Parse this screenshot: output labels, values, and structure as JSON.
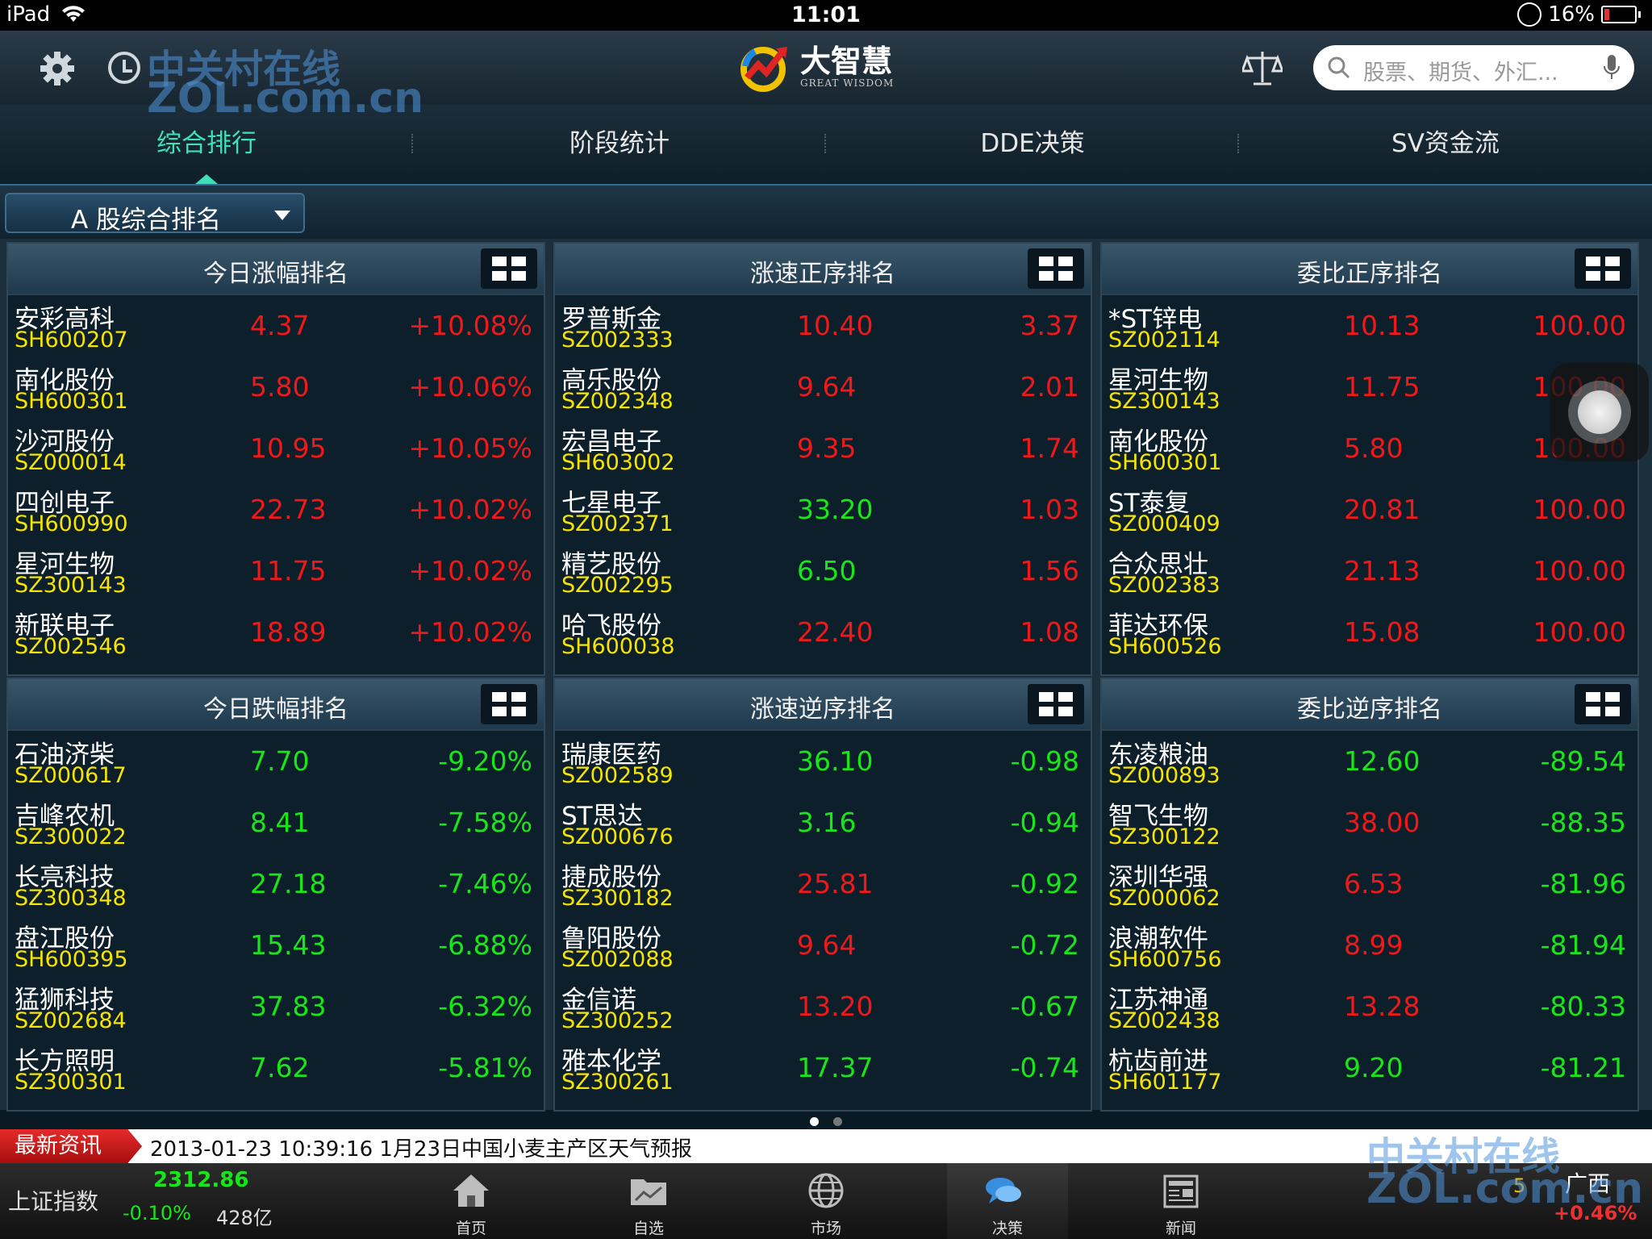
{
  "status": {
    "device": "iPad",
    "time": "11:01",
    "battery": "16%"
  },
  "header": {
    "brand": "大智慧",
    "brand_sub": "GREAT WISDOM",
    "search_placeholder": "股票、期货、外汇..."
  },
  "tabs": [
    {
      "label": "综合排行",
      "active": true
    },
    {
      "label": "阶段统计",
      "active": false
    },
    {
      "label": "DDE决策",
      "active": false
    },
    {
      "label": "SV资金流",
      "active": false
    }
  ],
  "dropdown": {
    "label": "A 股综合排名"
  },
  "panels": [
    {
      "title": "今日涨幅排名",
      "rows": [
        {
          "name": "安彩高科",
          "code": "SH600207",
          "price": "4.37",
          "price_color": "red",
          "value": "+10.08%",
          "value_color": "red"
        },
        {
          "name": "南化股份",
          "code": "SH600301",
          "price": "5.80",
          "price_color": "red",
          "value": "+10.06%",
          "value_color": "red"
        },
        {
          "name": "沙河股份",
          "code": "SZ000014",
          "price": "10.95",
          "price_color": "red",
          "value": "+10.05%",
          "value_color": "red"
        },
        {
          "name": "四创电子",
          "code": "SH600990",
          "price": "22.73",
          "price_color": "red",
          "value": "+10.02%",
          "value_color": "red"
        },
        {
          "name": "星河生物",
          "code": "SZ300143",
          "price": "11.75",
          "price_color": "red",
          "value": "+10.02%",
          "value_color": "red"
        },
        {
          "name": "新联电子",
          "code": "SZ002546",
          "price": "18.89",
          "price_color": "red",
          "value": "+10.02%",
          "value_color": "red"
        }
      ]
    },
    {
      "title": "涨速正序排名",
      "rows": [
        {
          "name": "罗普斯金",
          "code": "SZ002333",
          "price": "10.40",
          "price_color": "red",
          "value": "3.37",
          "value_color": "red"
        },
        {
          "name": "高乐股份",
          "code": "SZ002348",
          "price": "9.64",
          "price_color": "red",
          "value": "2.01",
          "value_color": "red"
        },
        {
          "name": "宏昌电子",
          "code": "SH603002",
          "price": "9.35",
          "price_color": "red",
          "value": "1.74",
          "value_color": "red"
        },
        {
          "name": "七星电子",
          "code": "SZ002371",
          "price": "33.20",
          "price_color": "green",
          "value": "1.03",
          "value_color": "red"
        },
        {
          "name": "精艺股份",
          "code": "SZ002295",
          "price": "6.50",
          "price_color": "green",
          "value": "1.56",
          "value_color": "red"
        },
        {
          "name": "哈飞股份",
          "code": "SH600038",
          "price": "22.40",
          "price_color": "red",
          "value": "1.08",
          "value_color": "red"
        }
      ]
    },
    {
      "title": "委比正序排名",
      "rows": [
        {
          "name": "*ST锌电",
          "code": "SZ002114",
          "price": "10.13",
          "price_color": "red",
          "value": "100.00",
          "value_color": "red"
        },
        {
          "name": "星河生物",
          "code": "SZ300143",
          "price": "11.75",
          "price_color": "red",
          "value": "100.00",
          "value_color": "red"
        },
        {
          "name": "南化股份",
          "code": "SH600301",
          "price": "5.80",
          "price_color": "red",
          "value": "100.00",
          "value_color": "red"
        },
        {
          "name": "ST泰复",
          "code": "SZ000409",
          "price": "20.81",
          "price_color": "red",
          "value": "100.00",
          "value_color": "red"
        },
        {
          "name": "合众思壮",
          "code": "SZ002383",
          "price": "21.13",
          "price_color": "red",
          "value": "100.00",
          "value_color": "red"
        },
        {
          "name": "菲达环保",
          "code": "SH600526",
          "price": "15.08",
          "price_color": "red",
          "value": "100.00",
          "value_color": "red"
        }
      ]
    },
    {
      "title": "今日跌幅排名",
      "rows": [
        {
          "name": "石油济柴",
          "code": "SZ000617",
          "price": "7.70",
          "price_color": "green",
          "value": "-9.20%",
          "value_color": "green"
        },
        {
          "name": "吉峰农机",
          "code": "SZ300022",
          "price": "8.41",
          "price_color": "green",
          "value": "-7.58%",
          "value_color": "green"
        },
        {
          "name": "长亮科技",
          "code": "SZ300348",
          "price": "27.18",
          "price_color": "green",
          "value": "-7.46%",
          "value_color": "green"
        },
        {
          "name": "盘江股份",
          "code": "SH600395",
          "price": "15.43",
          "price_color": "green",
          "value": "-6.88%",
          "value_color": "green"
        },
        {
          "name": "猛狮科技",
          "code": "SZ002684",
          "price": "37.83",
          "price_color": "green",
          "value": "-6.32%",
          "value_color": "green"
        },
        {
          "name": "长方照明",
          "code": "SZ300301",
          "price": "7.62",
          "price_color": "green",
          "value": "-5.81%",
          "value_color": "green"
        }
      ]
    },
    {
      "title": "涨速逆序排名",
      "rows": [
        {
          "name": "瑞康医药",
          "code": "SZ002589",
          "price": "36.10",
          "price_color": "green",
          "value": "-0.98",
          "value_color": "green"
        },
        {
          "name": "ST思达",
          "code": "SZ000676",
          "price": "3.16",
          "price_color": "green",
          "value": "-0.94",
          "value_color": "green"
        },
        {
          "name": "捷成股份",
          "code": "SZ300182",
          "price": "25.81",
          "price_color": "red",
          "value": "-0.92",
          "value_color": "green"
        },
        {
          "name": "鲁阳股份",
          "code": "SZ002088",
          "price": "9.64",
          "price_color": "red",
          "value": "-0.72",
          "value_color": "green"
        },
        {
          "name": "金信诺",
          "code": "SZ300252",
          "price": "13.20",
          "price_color": "red",
          "value": "-0.67",
          "value_color": "green"
        },
        {
          "name": "雅本化学",
          "code": "SZ300261",
          "price": "17.37",
          "price_color": "green",
          "value": "-0.74",
          "value_color": "green"
        }
      ]
    },
    {
      "title": "委比逆序排名",
      "rows": [
        {
          "name": "东凌粮油",
          "code": "SZ000893",
          "price": "12.60",
          "price_color": "green",
          "value": "-89.54",
          "value_color": "green"
        },
        {
          "name": "智飞生物",
          "code": "SZ300122",
          "price": "38.00",
          "price_color": "red",
          "value": "-88.35",
          "value_color": "green"
        },
        {
          "name": "深圳华强",
          "code": "SZ000062",
          "price": "6.53",
          "price_color": "red",
          "value": "-81.96",
          "value_color": "green"
        },
        {
          "name": "浪潮软件",
          "code": "SH600756",
          "price": "8.99",
          "price_color": "red",
          "value": "-81.94",
          "value_color": "green"
        },
        {
          "name": "江苏神通",
          "code": "SZ002438",
          "price": "13.28",
          "price_color": "red",
          "value": "-80.33",
          "value_color": "green"
        },
        {
          "name": "杭齿前进",
          "code": "SH601177",
          "price": "9.20",
          "price_color": "green",
          "value": "-81.21",
          "value_color": "green"
        }
      ]
    }
  ],
  "news": {
    "label": "最新资讯",
    "text": "2013-01-23 10:39:16 1月23日中国小麦主产区天气预报"
  },
  "index": {
    "name": "上证指数",
    "value": "2312.86",
    "change": "-0.10%",
    "volume": "428亿"
  },
  "nav": [
    {
      "label": "首页",
      "icon": "home-icon",
      "active": false
    },
    {
      "label": "自选",
      "icon": "folder-chart-icon",
      "active": false
    },
    {
      "label": "市场",
      "icon": "globe-icon",
      "active": false
    },
    {
      "label": "决策",
      "icon": "chat-bubbles-icon",
      "active": true
    },
    {
      "label": "新闻",
      "icon": "newspaper-icon",
      "active": false
    }
  ],
  "region": {
    "name": "广西",
    "change": "+0.46%",
    "indicator": "5"
  },
  "watermark": {
    "cn": "中关村在线",
    "en": "ZOL.com.cn"
  },
  "colors": {
    "up": "#f01818",
    "down": "#19e619",
    "code": "#f5e400",
    "accent": "#3ee0b8"
  }
}
